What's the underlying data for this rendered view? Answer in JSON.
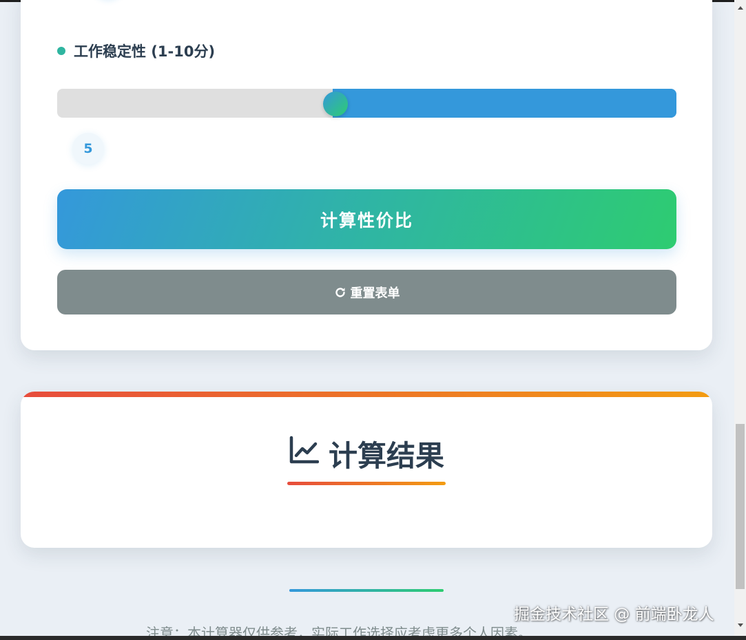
{
  "form": {
    "field": {
      "label": "工作稳定性 (1-10分)",
      "value": "5",
      "min": 1,
      "max": 10,
      "level": 5
    },
    "calculate_label": "计算性价比",
    "reset_label": "重置表单",
    "reset_icon": "redo-icon"
  },
  "result": {
    "title": "计算结果",
    "title_icon": "line-chart-icon"
  },
  "footer": {
    "note": "注意：本计算器仅供参考，实际工作选择应考虑更多个人因素。"
  },
  "watermark": "掘金技术社区 @ 前端卧龙人",
  "colors": {
    "primary": "#3498db",
    "secondary": "#2ecc71",
    "reset": "#7f8c8d",
    "accent_red": "#e74c3c",
    "accent_orange": "#f39c12",
    "text": "#2c3e50"
  }
}
